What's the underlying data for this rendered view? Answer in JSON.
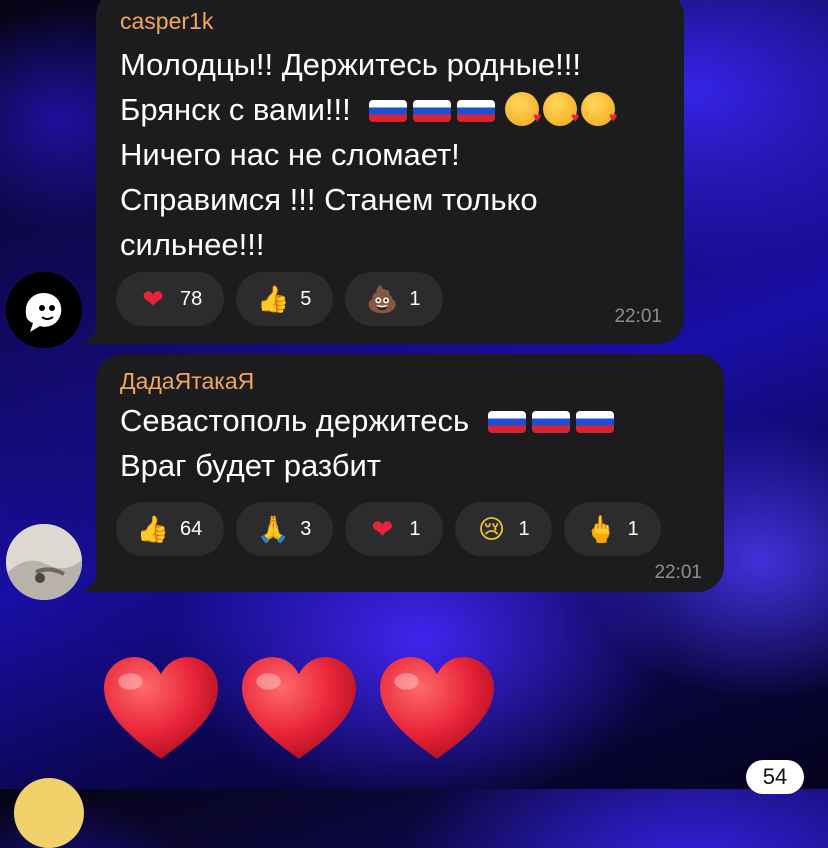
{
  "messages": [
    {
      "author": "casper1k",
      "lines": [
        "Молодцы!! Держитесь родные!!!",
        "Брянск с вами!!!",
        "Ничего нас не сломает!",
        "Справимся !!! Станем только",
        "сильнее!!!"
      ],
      "line_emoji": [
        "flag-russia",
        "flag-russia",
        "flag-russia",
        "kissing-face-heart",
        "kissing-face-heart",
        "kissing-face-heart"
      ],
      "reactions": [
        {
          "icon": "red-heart",
          "count": "78"
        },
        {
          "icon": "thumbs-up",
          "count": "5"
        },
        {
          "icon": "pile-of-poo",
          "count": "1"
        }
      ],
      "time": "22:01"
    },
    {
      "author": "ДадаЯтакаЯ",
      "lines": [
        "Севастополь держитесь",
        "Враг будет разбит"
      ],
      "line_emoji": [
        "flag-russia",
        "flag-russia",
        "flag-russia"
      ],
      "reactions": [
        {
          "icon": "thumbs-up",
          "count": "64"
        },
        {
          "icon": "folded-hands",
          "count": "3"
        },
        {
          "icon": "red-heart",
          "count": "1"
        },
        {
          "icon": "crying-face",
          "count": "1"
        },
        {
          "icon": "middle-finger",
          "count": "1"
        }
      ],
      "time": "22:01"
    }
  ],
  "big_emoji": [
    "red-heart",
    "red-heart",
    "red-heart"
  ],
  "unread_badge": "54",
  "colors": {
    "bubble": "#1c1c1e",
    "chip": "#2c2c2e",
    "author": "#f2a85c",
    "time": "#8e8e93",
    "heart": "#e8243a"
  }
}
